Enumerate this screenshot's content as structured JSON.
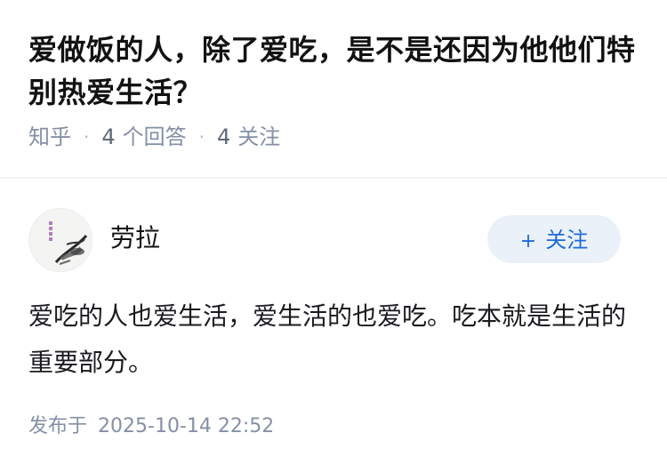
{
  "question": {
    "title": "爱做饭的人，除了爱吃，是不是还因为他他们特别热爱生活？",
    "source": "知乎",
    "answer_count": "4",
    "answer_label": "个回答",
    "follower_count": "4",
    "follower_label": "关注"
  },
  "answer": {
    "author_name": "劳拉",
    "follow_label": "关注",
    "content": "爱吃的人也爱生活，爱生活的也爱吃。吃本就是生活的重要部分。",
    "published_label": "发布于",
    "published_time": "2025-10-14 22:52"
  },
  "colors": {
    "accent": "#1d6ad6",
    "follow_bg": "#ebf1f9",
    "meta": "#8590a6"
  },
  "icons": {
    "avatar": "ink-painting-avatar",
    "follow": "plus-icon"
  }
}
